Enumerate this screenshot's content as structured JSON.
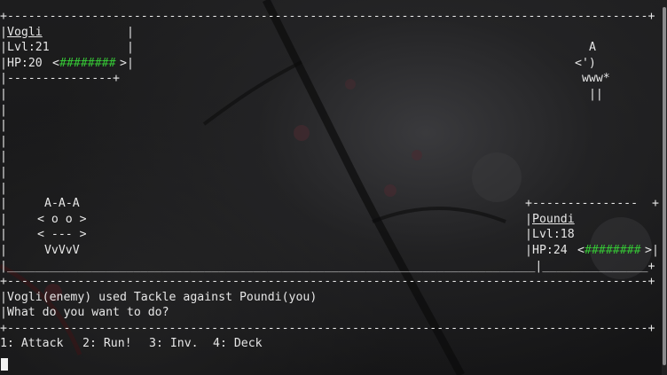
{
  "border_full": "+-------------------------------------------------------------------------------------------+",
  "border_bottom_battle": "|___________________________________________________________________________|_______________+",
  "enemy": {
    "top_left_border": "+",
    "box_right": "|",
    "name": "Vogli",
    "level_label": "Lvl:21",
    "hp_label": "HP:20",
    "hp_bar_open": "<",
    "hp_bar_fill": "########",
    "hp_bar_close": ">",
    "box_bottom": "|---------------+",
    "sprite": [
      " A",
      "<')",
      " www*",
      " ||"
    ]
  },
  "player": {
    "box_top": "+---------------",
    "name": "Poundi",
    "level_label": "Lvl:18",
    "hp_label": "HP:24",
    "hp_bar_open": "<",
    "hp_bar_fill": "########",
    "hp_bar_close": ">",
    "sprite": [
      "A-A-A",
      "< o o >",
      "< --- >",
      " VvVvV"
    ]
  },
  "side_bar_char": "|",
  "log": {
    "line1": "|Vogli(enemy) used Tackle against Poundi(you)",
    "line2": "|What do you want to do?"
  },
  "menu": {
    "attack": "1: Attack",
    "run": "2: Run!",
    "inventory": "3: Inv.",
    "deck": "4: Deck"
  },
  "colors": {
    "hp_bar": "#35c635",
    "text": "#e6e6e6",
    "background": "#161617"
  }
}
